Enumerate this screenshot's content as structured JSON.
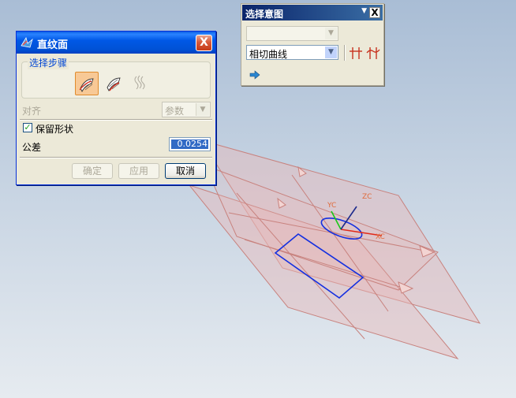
{
  "dialog": {
    "title": "直纹面",
    "close_label": "X",
    "steps_group_label": "选择步骤",
    "steps": [
      {
        "name": "section-string-1-step",
        "active": true
      },
      {
        "name": "section-string-2-step",
        "active": false
      },
      {
        "name": "spine-step",
        "active": false
      }
    ],
    "alignment_label": "对齐",
    "alignment_value": "参数",
    "keep_shape_label": "保留形状",
    "keep_shape_checked": true,
    "tolerance_label": "公差",
    "tolerance_value": "0.0254",
    "ok_label": "确定",
    "apply_label": "应用",
    "cancel_label": "取消"
  },
  "selection_intent": {
    "title": "选择意图",
    "close_label": "X",
    "filter_value": "",
    "curve_rule_value": "相切曲线",
    "icons": [
      "stop-at-intersection-icon",
      "follow-fillet-icon",
      "next-step-arrow-icon"
    ]
  },
  "viewport": {
    "axis_labels": {
      "xc": "XC",
      "yc": "YC",
      "zc": "ZC"
    },
    "colors": {
      "background_top": "#a9bdd5",
      "background_bottom": "#e6ebf0",
      "plane_fill": "#e8b8b8",
      "plane_edge": "#c8827e",
      "selected_curve": "#1530e0",
      "x_axis": "#e02a1a",
      "y_axis": "#18c818",
      "z_axis": "#1c2a8c"
    }
  }
}
